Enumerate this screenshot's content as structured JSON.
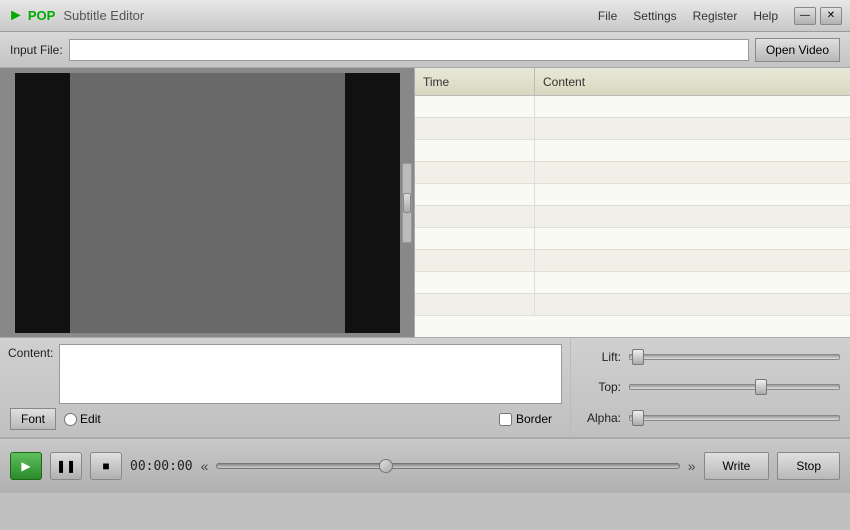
{
  "titleBar": {
    "appName": "POP Subtitle Editor",
    "appAbbr": "POP",
    "appSubtitle": "Subtitle Editor",
    "menu": {
      "file": "File",
      "settings": "Settings",
      "register": "Register",
      "help": "Help"
    },
    "windowControls": {
      "minimize": "—",
      "close": "✕"
    }
  },
  "inputBar": {
    "label": "Input File:",
    "placeholder": "",
    "openVideoBtn": "Open Video"
  },
  "subtitleTable": {
    "columns": {
      "time": "Time",
      "content": "Content"
    },
    "rows": []
  },
  "contentArea": {
    "contentLabel": "Content:",
    "fontBtn": "Font",
    "editLabel": "Edit",
    "borderLabel": "Border",
    "sliders": {
      "lift": {
        "label": "Lift:",
        "value": 0
      },
      "top": {
        "label": "Top:",
        "value": 60
      },
      "alpha": {
        "label": "Alpha:",
        "value": 0
      }
    }
  },
  "playbackBar": {
    "timeDisplay": "00:00:00",
    "writeBtn": "Write",
    "stopBtn": "Stop"
  }
}
